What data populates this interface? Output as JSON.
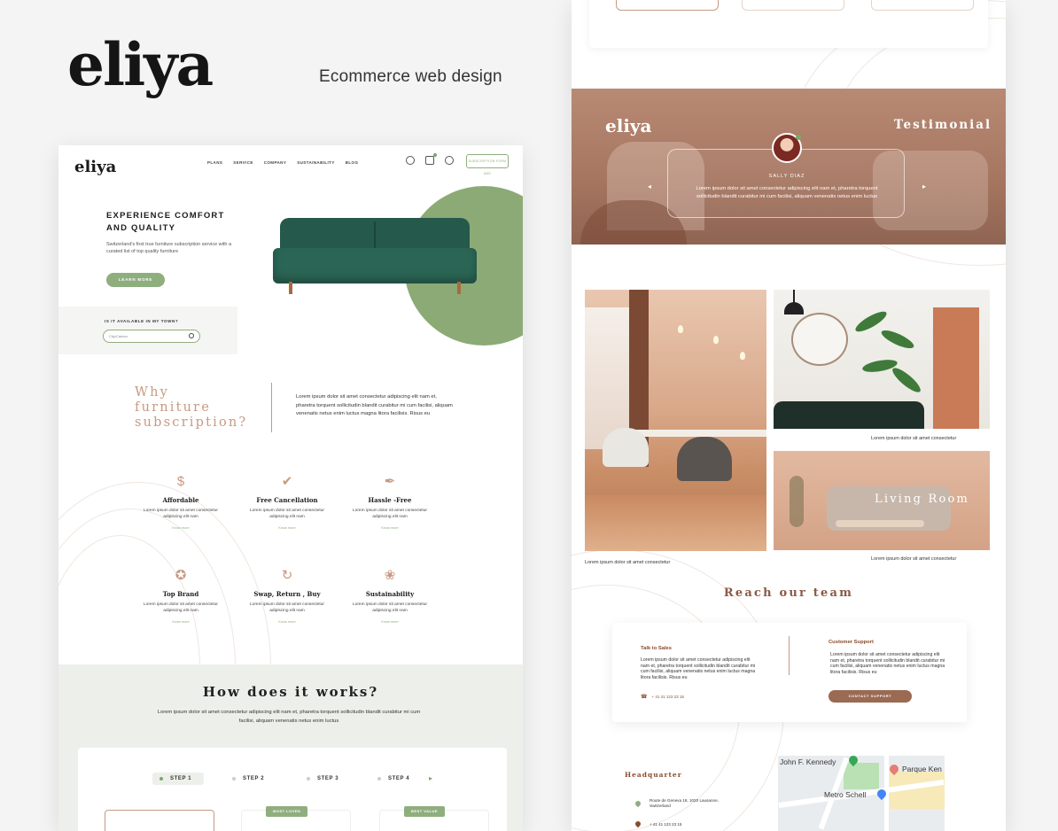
{
  "presentation": {
    "logo": "eliya",
    "subtitle": "Ecommerce web design"
  },
  "left_page": {
    "nav": {
      "logo": "eliya",
      "menu": [
        "PLANS",
        "SERVICE",
        "COMPANY",
        "SUSTAINABILITY",
        "BLOG"
      ],
      "icons": [
        "user-icon",
        "cart-icon",
        "globe-icon"
      ],
      "cta": "SUBSCRIPTION FORM ABO"
    },
    "hero": {
      "title": "EXPERIENCE COMFORT AND QUALITY",
      "text": "Switzerland's first true furniture subscription service with a curated list of top quality furniture",
      "button": "LEARN MORE"
    },
    "availability": {
      "label": "IS IT AVAILABLE IN MY TOWN?",
      "placeholder": "City/Canton"
    },
    "why": {
      "title_line1": "Why",
      "title_line2": "furniture",
      "title_line3": "subscription?",
      "text": "Lorem ipsum dolor sit amet consectetur adipiscing elit nam et, pharetra torquent sollicitudin blandit curabitur mi cum facilisi, aliquam venenatis netus enim luctus magna litora facilisis. Risus eu"
    },
    "features": [
      {
        "title": "Affordable",
        "text": "Lorem ipsum dolor sit amet consectetur adipiscing elit nam",
        "more": "Know more",
        "icon": "money-bag-icon"
      },
      {
        "title": "Free Cancellation",
        "text": "Lorem ipsum dolor sit amet consectetur adipiscing elit nam",
        "more": "Know more",
        "icon": "tag-icon"
      },
      {
        "title": "Hassle -Free",
        "text": "Lorem ipsum dolor sit amet consectetur adipiscing elit nam",
        "more": "Know more",
        "icon": "feather-icon"
      },
      {
        "title": "Top Brand",
        "text": "Lorem ipsum dolor sit amet consectetur adipiscing elit nam",
        "more": "Know more",
        "icon": "badge-icon"
      },
      {
        "title": "Swap, Return , Buy",
        "text": "Lorem ipsum dolor sit amet consectetur adipiscing elit nam",
        "more": "Know more",
        "icon": "swap-icon"
      },
      {
        "title": "Sustainability",
        "text": "Lorem ipsum dolor sit amet consectetur adipiscing elit nam",
        "more": "Know more",
        "icon": "sprout-icon"
      }
    ],
    "how": {
      "title": "How does it works?",
      "text": "Lorem ipsum dolor sit amet consectetur adipiscing elit nam et, pharetra torquent sollicitudin blandit curabitur mi cum facilisi, aliquam venenatis netus enim luctus",
      "steps": [
        "STEP 1",
        "STEP 2",
        "STEP 3",
        "STEP 4"
      ],
      "badges": [
        "MOST LOVED",
        "BEST VALUE"
      ]
    }
  },
  "right_page": {
    "testimonial": {
      "logo": "eliya",
      "title": "Testimonial",
      "name": "SALLY DIAZ",
      "quote": "Lorem ipsum dolor sit amet consectetur adipiscing elit nam et, pharetra torquent sollicitudin blandit curabitur mi cum facilisi, aliquam venenatis netus enim luctus"
    },
    "gallery": {
      "living_label": "Living Room",
      "caption_plant": "Lorem ipsum dolor sit amet consectetur",
      "caption_dining": "Lorem ipsum dolor sit amet consectetur",
      "caption_living": "Lorem ipsum dolor sit amet consectetur"
    },
    "reach": {
      "title": "Reach our team",
      "sales_title": "Talk to Sales",
      "sales_text": "Lorem ipsum dolor sit amet consectetur adipiscing elit nam et, pharetra torquent sollicitudin blandit curabitur mi cum facilisi, aliquam venenatis netus enim luctus magna litora facilisis. Risus eu",
      "sales_phone": "+ 41 41 123 23 15",
      "support_title": "Customer Support",
      "support_text": "Lorem ipsum dolor sit amet consectetur adipiscing elit nam et, pharetra torquent sollicitudin blandit curabitur mi cum facilisi, aliquam venenatis netus enim luctus magna litora facilisis. Risus eu",
      "support_button": "CONTACT SUPPORT"
    },
    "hq": {
      "title": "Headquarter",
      "address": "Route de Geneva 18, 1020 Lausanne, Switzerland",
      "phone": "+ 41 41 123 23 15",
      "map_labels": [
        "John F. Kennedy",
        "Parque Ken",
        "Metro Schell"
      ]
    }
  },
  "colors": {
    "sage": "#8fae7e",
    "clay": "#c79a80",
    "brown": "#8a4a2c",
    "sofa_green": "#24594b"
  }
}
